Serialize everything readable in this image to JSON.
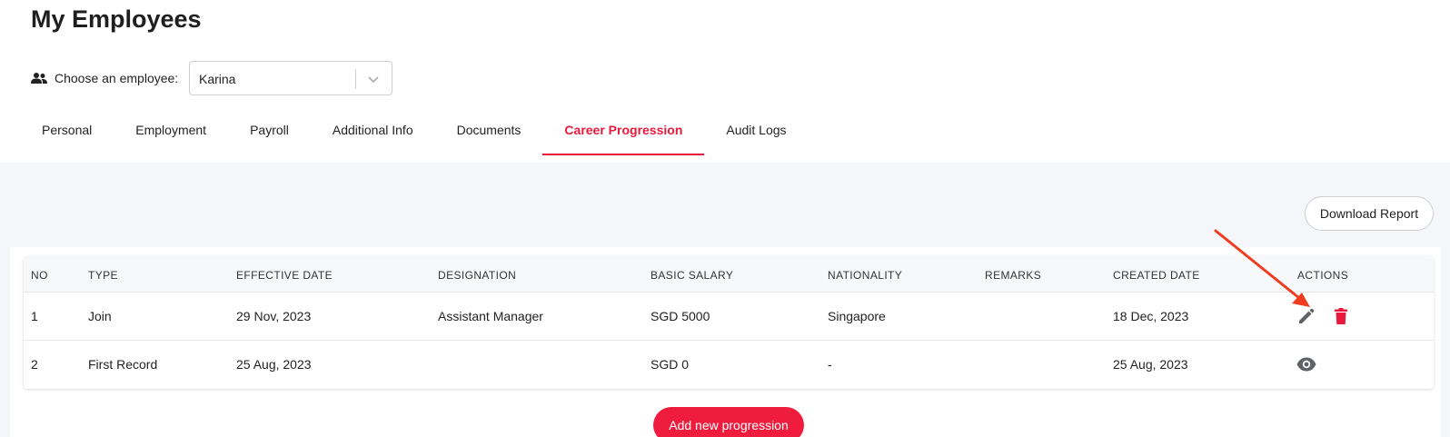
{
  "page": {
    "title": "My Employees"
  },
  "chooser": {
    "label": "Choose an employee:",
    "selected": "Karina",
    "icon": "users-icon"
  },
  "tabs": [
    {
      "label": "Personal"
    },
    {
      "label": "Employment"
    },
    {
      "label": "Payroll"
    },
    {
      "label": "Additional Info"
    },
    {
      "label": "Documents"
    },
    {
      "label": "Career Progression",
      "active": true
    },
    {
      "label": "Audit Logs"
    }
  ],
  "toolbar": {
    "download_label": "Download Report"
  },
  "table": {
    "headers": [
      "NO",
      "TYPE",
      "EFFECTIVE DATE",
      "DESIGNATION",
      "BASIC SALARY",
      "NATIONALITY",
      "REMARKS",
      "CREATED DATE",
      "ACTIONS"
    ],
    "rows": [
      {
        "no": "1",
        "type": "Join",
        "effective_date": "29 Nov, 2023",
        "designation": "Assistant Manager",
        "basic_salary": "SGD 5000",
        "nationality": "Singapore",
        "remarks": "",
        "created_date": "18 Dec, 2023",
        "actions": [
          "pencil-icon",
          "trash-icon"
        ]
      },
      {
        "no": "2",
        "type": "First Record",
        "effective_date": "25 Aug, 2023",
        "designation": "",
        "basic_salary": "SGD 0",
        "nationality": "-",
        "remarks": "",
        "created_date": "25 Aug, 2023",
        "actions": [
          "eye-icon"
        ]
      }
    ]
  },
  "footer": {
    "add_label": "Add new progression"
  },
  "colors": {
    "accent": "#e8193c",
    "button_red": "#ef1c3e",
    "annotation_arrow": "#f03c1e",
    "icon_gray": "#5f6368"
  }
}
